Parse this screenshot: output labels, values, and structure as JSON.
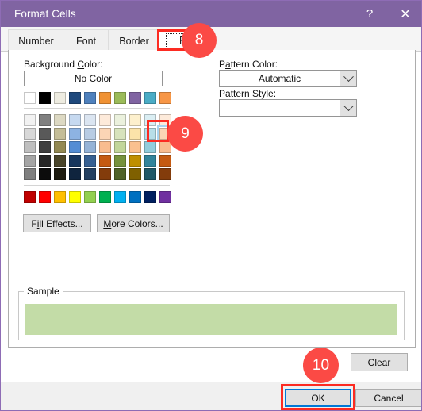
{
  "window": {
    "title": "Format Cells",
    "accent_color": "#8064a2",
    "help_icon": "?",
    "close_icon": "✕"
  },
  "tabs": [
    {
      "label": "Number",
      "active": false
    },
    {
      "label": "Font",
      "active": false
    },
    {
      "label": "Border",
      "active": false
    },
    {
      "label": "Fill",
      "active": true
    }
  ],
  "fill_tab": {
    "background_color_label_pre": "Background ",
    "background_color_label_key": "C",
    "background_color_label_post": "olor:",
    "no_color_button": "No Color",
    "fill_effects_pre": "F",
    "fill_effects_key": "i",
    "fill_effects_post": "ll Effects...",
    "more_colors_key": "M",
    "more_colors_post": "ore Colors...",
    "pattern_color_label_pre": "P",
    "pattern_color_label_key": "a",
    "pattern_color_label_post": "ttern Color:",
    "pattern_color_value": "Automatic",
    "pattern_style_label_key": "P",
    "pattern_style_label_post": "attern Style:",
    "pattern_style_value": "",
    "sample_legend": "Sample",
    "sample_fill_color": "#c3dca7",
    "clear_pre": "Clea",
    "clear_key": "r",
    "selected_swatch_color": "#c3dca7"
  },
  "footer": {
    "ok_label": "OK",
    "cancel_label": "Cancel"
  },
  "palette": {
    "theme_base_row": [
      "#ffffff",
      "#000000",
      "#eeece1",
      "#1f497d",
      "#4f81bd",
      "#f09234",
      "#9bbb59",
      "#8064a2",
      "#4bacc6",
      "#f79646"
    ],
    "theme_tint_rows": [
      [
        "#f2f2f2",
        "#808080",
        "#ddd9c3",
        "#c6d9f0",
        "#dbe5f1",
        "#fdeada",
        "#ebf1dd",
        "#fdf0cd",
        "#daeef3",
        "#fdeada"
      ],
      [
        "#d8d8d8",
        "#595959",
        "#c4bd97",
        "#8db3e2",
        "#b8cce4",
        "#fbd5b5",
        "#d7e3bc",
        "#fbe3a9",
        "#b7dee8",
        "#fbd5b5"
      ],
      [
        "#bfbfbf",
        "#3f3f3f",
        "#938953",
        "#548dd4",
        "#95b3d7",
        "#f9bc8f",
        "#c2d69a",
        "#fac08f",
        "#92cddc",
        "#f9bc8f"
      ],
      [
        "#a5a5a5",
        "#262626",
        "#494429",
        "#17365d",
        "#366092",
        "#c55a11",
        "#76923c",
        "#bf8f00",
        "#31849b",
        "#c55a11"
      ],
      [
        "#7f7f7f",
        "#0c0c0c",
        "#1d1b10",
        "#0f243e",
        "#244061",
        "#833c0b",
        "#4f6228",
        "#7f6000",
        "#205867",
        "#833c0b"
      ]
    ],
    "standard_row": [
      "#c00000",
      "#ff0000",
      "#ffc000",
      "#ffff00",
      "#92d050",
      "#00b050",
      "#00b0f0",
      "#0070c0",
      "#002060",
      "#7030a0"
    ],
    "selected_index": {
      "row": 2,
      "col": 10
    }
  },
  "annotations": [
    {
      "badge": "8",
      "target": "fill-tab"
    },
    {
      "badge": "9",
      "target": "selected-swatch"
    },
    {
      "badge": "10",
      "target": "ok-button"
    }
  ]
}
